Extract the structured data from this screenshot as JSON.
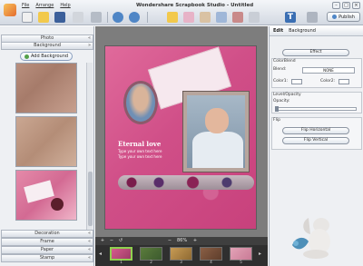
{
  "app": {
    "title": "Wondershare Scrapbook Studio - Untitled"
  },
  "menu": {
    "items": [
      "File",
      "Arrange",
      "Help"
    ]
  },
  "toolbar": {
    "publish_label": "Publish"
  },
  "left_panel": {
    "photo_bar": "Photo",
    "background_bar": "Background",
    "add_background_label": "Add Background",
    "decoration_bar": "Decoration",
    "frame_bar": "Frame",
    "paper_bar": "Paper",
    "stamp_bar": "Stamp"
  },
  "canvas": {
    "title": "Eternal love",
    "line1": "Type your own text here",
    "line2": "Type your own text here"
  },
  "zoom": {
    "value": "86%"
  },
  "pages": [
    "1",
    "2",
    "3",
    "4",
    "5"
  ],
  "right_panel": {
    "tab_edit": "Edit",
    "tab_background": "Background",
    "effect_label": "Effect",
    "colorblend_label": "ColorBlend",
    "blend_label": "Blend:",
    "blend_value": "NONE",
    "color1_label": "Color1:",
    "color2_label": "Color2:",
    "level_opacity_label": "Level/Opacity",
    "opacity_label": "Opacity:",
    "flip_label": "Flip",
    "flip_horizontal_label": "Flip Horizontal",
    "flip_vertical_label": "Flip Vertical"
  }
}
